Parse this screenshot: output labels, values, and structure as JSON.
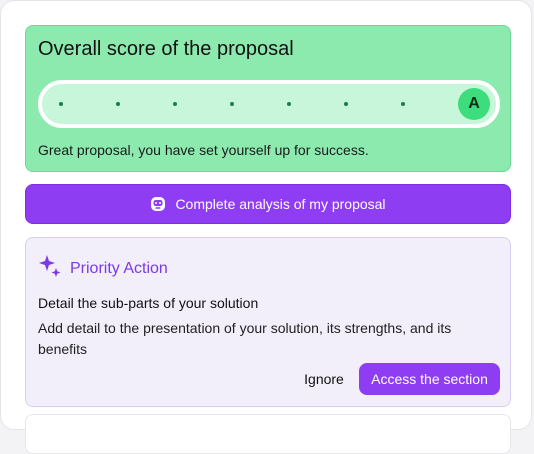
{
  "score": {
    "title": "Overall score of the proposal",
    "grade": "A",
    "progress_percent": 100,
    "step_count": 7,
    "message": "Great proposal, you have set yourself up for success."
  },
  "analysis_button": {
    "label": "Complete analysis of my proposal",
    "icon": "robot-icon"
  },
  "priority": {
    "heading": "Priority Action",
    "icon": "sparkles-icon",
    "action_title": "Detail the sub-parts of your solution",
    "action_description": "Add detail to the presentation of your solution, its strengths, and its benefits",
    "ignore_label": "Ignore",
    "access_label": "Access the section"
  },
  "colors": {
    "score_bg": "#8ceaaf",
    "accent_purple": "#8f3df2",
    "grade_green": "#3ddc7c",
    "priority_bg": "#f2effb"
  }
}
